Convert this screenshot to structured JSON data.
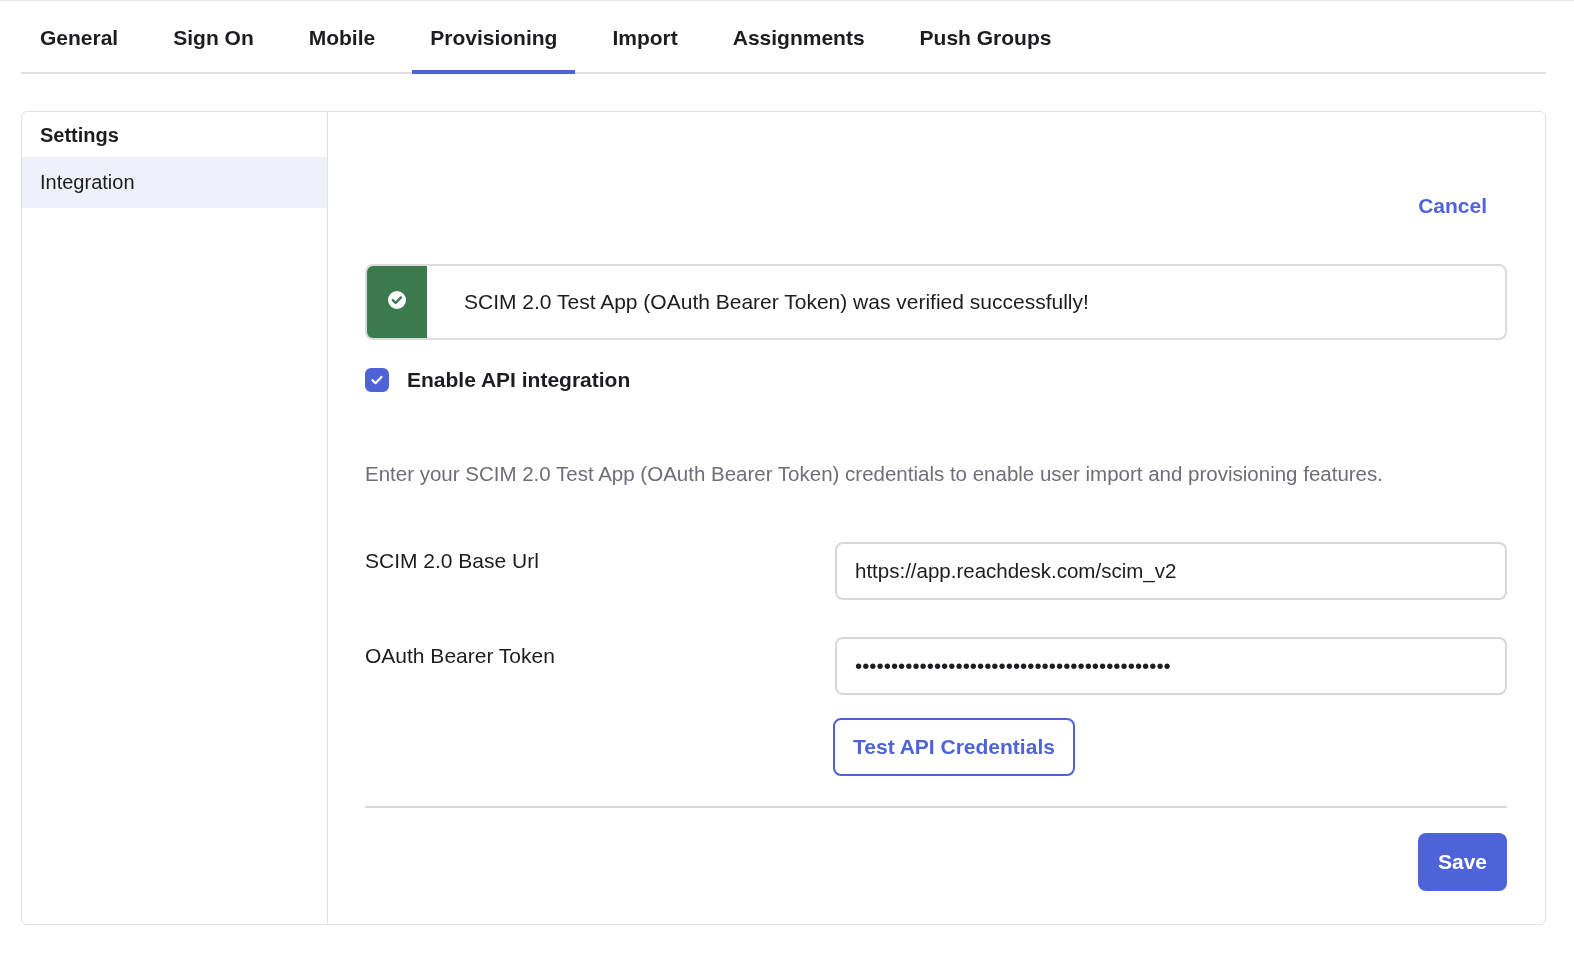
{
  "tabs": [
    {
      "label": "General",
      "selected": false
    },
    {
      "label": "Sign On",
      "selected": false
    },
    {
      "label": "Mobile",
      "selected": false
    },
    {
      "label": "Provisioning",
      "selected": true
    },
    {
      "label": "Import",
      "selected": false
    },
    {
      "label": "Assignments",
      "selected": false
    },
    {
      "label": "Push Groups",
      "selected": false
    }
  ],
  "sidebar": {
    "heading": "Settings",
    "items": [
      {
        "label": "Integration",
        "selected": true
      }
    ]
  },
  "cancel_link": "Cancel",
  "success_banner": {
    "message": "SCIM 2.0 Test App (OAuth Bearer Token) was verified successfully!"
  },
  "enable_api": {
    "label": "Enable API integration",
    "checked": true
  },
  "description": "Enter your SCIM 2.0 Test App (OAuth Bearer Token) credentials to enable user import and provisioning features.",
  "fields": [
    {
      "label": "SCIM 2.0 Base Url",
      "value": "https://app.reachdesk.com/scim_v2"
    },
    {
      "label": "OAuth Bearer Token",
      "value": "••••••••••••••••••••••••••••••••••••••••••••"
    }
  ],
  "test_button": "Test API Credentials",
  "save_button": "Save"
}
